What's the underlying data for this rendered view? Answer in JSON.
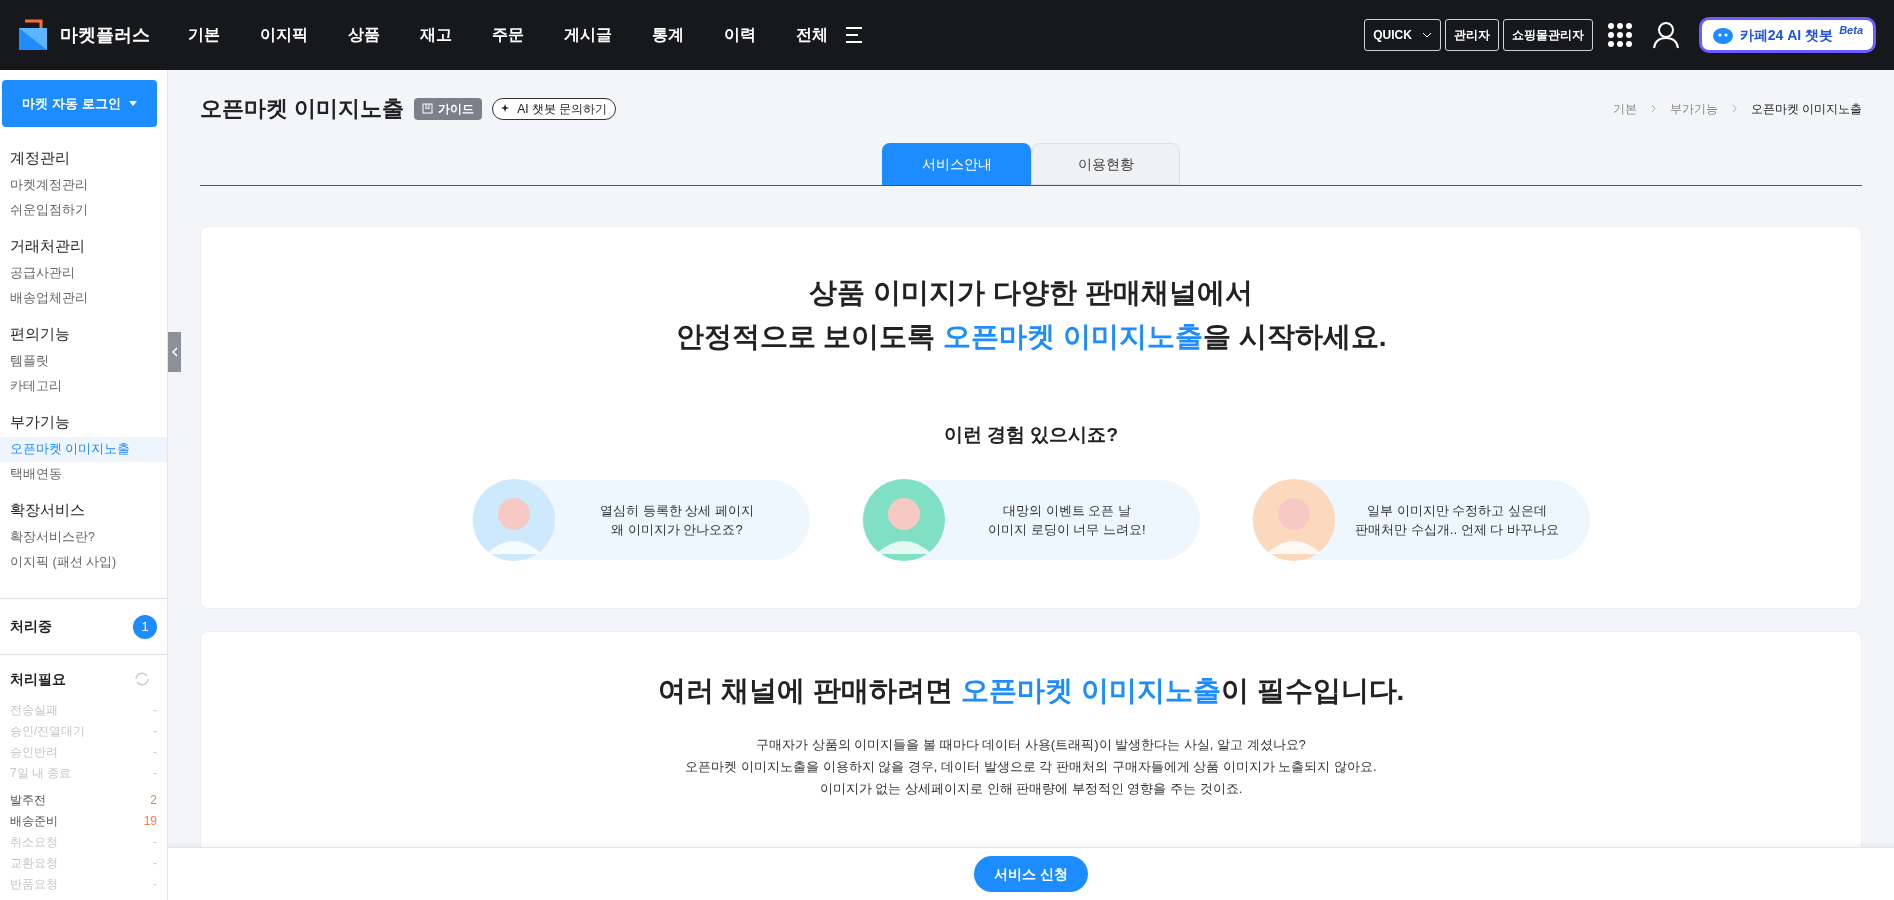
{
  "brand": "마켓플러스",
  "nav": [
    "기본",
    "이지픽",
    "상품",
    "재고",
    "주문",
    "게시글",
    "통계",
    "이력",
    "전체"
  ],
  "header_buttons": [
    {
      "label": "QUICK",
      "kind": "dropdown"
    },
    {
      "label": "관리자",
      "kind": "plain"
    },
    {
      "label": "쇼핑몰관리자",
      "kind": "plain"
    }
  ],
  "chatbot": {
    "label": "카페24 AI 챗봇",
    "badge": "Beta"
  },
  "sidebar": {
    "login_button": "마켓 자동 로그인",
    "sections": [
      {
        "title": "계정관리",
        "items": [
          {
            "label": "마켓계정관리",
            "selected": false
          },
          {
            "label": "쉬운입점하기",
            "selected": false
          }
        ]
      },
      {
        "title": "거래처관리",
        "items": [
          {
            "label": "공급사관리",
            "selected": false
          },
          {
            "label": "배송업체관리",
            "selected": false
          }
        ]
      },
      {
        "title": "편의기능",
        "items": [
          {
            "label": "템플릿",
            "selected": false
          },
          {
            "label": "카테고리",
            "selected": false
          }
        ]
      },
      {
        "title": "부가기능",
        "items": [
          {
            "label": "오픈마켓 이미지노출",
            "selected": true
          },
          {
            "label": "택배연동",
            "selected": false
          }
        ]
      },
      {
        "title": "확장서비스",
        "items": [
          {
            "label": "확장서비스란?",
            "selected": false
          },
          {
            "label": "이지픽 (패션 사입)",
            "selected": false
          }
        ]
      }
    ],
    "processing": {
      "label": "처리중",
      "count": "1"
    },
    "needs_action": {
      "label": "처리필요",
      "groups": [
        [
          {
            "label": "전송실패",
            "count": "-",
            "disabled": true
          },
          {
            "label": "승인/진열대기",
            "count": "-",
            "disabled": true
          },
          {
            "label": "승인반려",
            "count": "-",
            "disabled": true
          },
          {
            "label": "7일 내 종료",
            "count": "-",
            "disabled": true
          }
        ],
        [
          {
            "label": "발주전",
            "count": "2",
            "disabled": false
          },
          {
            "label": "배송준비",
            "count": "19",
            "disabled": false
          },
          {
            "label": "취소요청",
            "count": "-",
            "disabled": true
          },
          {
            "label": "교환요청",
            "count": "-",
            "disabled": true
          },
          {
            "label": "반품요청",
            "count": "-",
            "disabled": true
          }
        ]
      ]
    }
  },
  "page": {
    "title": "오픈마켓 이미지노출",
    "guide_button": "가이드",
    "ai_button": "AI 챗봇 문의하기",
    "breadcrumb": [
      "기본",
      "부가기능",
      "오픈마켓 이미지노출"
    ],
    "tabs": [
      {
        "label": "서비스안내",
        "selected": true
      },
      {
        "label": "이용현황",
        "selected": false
      }
    ]
  },
  "intro_card": {
    "headline": [
      [
        {
          "text": "상품 이미지가 다양한 판매채널에서",
          "highlight": false
        }
      ],
      [
        {
          "text": "안정적으로 보이도록 ",
          "highlight": false
        },
        {
          "text": "오픈마켓 이미지노출",
          "highlight": true
        },
        {
          "text": "을 시작하세요.",
          "highlight": false
        }
      ]
    ],
    "question": "이런 경험 있으시죠?",
    "bubbles": [
      {
        "lines": [
          "열심히 등록한 상세 페이지",
          "왜 이미지가 안나오죠?"
        ],
        "color": "#cde9fb"
      },
      {
        "lines": [
          "대망의 이벤트 오픈 날",
          "이미지 로딩이 너무 느려요!"
        ],
        "color": "#7fe0c4"
      },
      {
        "lines": [
          "일부 이미지만 수정하고 싶은데",
          "판매처만 수십개.. 언제 다 바꾸나요"
        ],
        "color": "#fcd9bd"
      }
    ]
  },
  "need_card": {
    "headline": [
      {
        "text": "여러 채널에 판매하려면 ",
        "highlight": false
      },
      {
        "text": "오픈마켓 이미지노출",
        "highlight": true
      },
      {
        "text": "이 필수입니다.",
        "highlight": false
      }
    ],
    "body": [
      "구매자가 상품의 이미지들을 볼 때마다 데이터 사용(트래픽)이 발생한다는 사실, 알고 계셨나요?",
      "오픈마켓 이미지노출을 이용하지 않을 경우, 데이터 발생으로 각 판매처의 구매자들에게 상품 이미지가 노출되지 않아요.",
      "이미지가 없는 상세페이지로 인해 판매량에 부정적인 영향을 주는 것이죠."
    ]
  },
  "apply_button": "서비스 신청"
}
